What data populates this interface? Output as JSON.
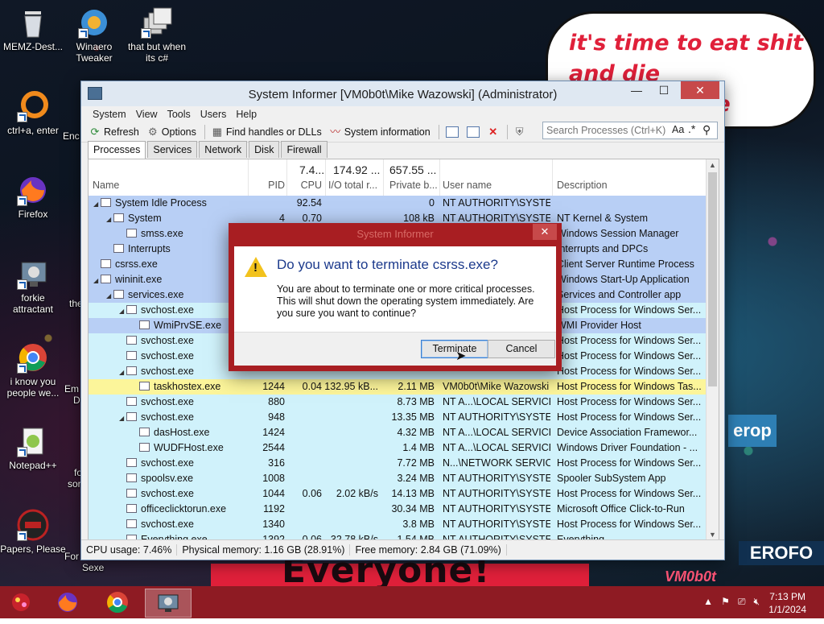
{
  "desktop": {
    "icons": [
      {
        "label": "MEMZ-Dest..."
      },
      {
        "label": "Winaero Tweaker"
      },
      {
        "label": "that but when its c#"
      },
      {
        "label": "ctrl+a, enter"
      },
      {
        "label": "Firefox"
      },
      {
        "label": "forkie attractant"
      },
      {
        "label": "i know you people we..."
      },
      {
        "label": "Notepad++"
      },
      {
        "label": "Papers, Please"
      }
    ],
    "partial_labels": {
      "enc": "Enc",
      "the": "the",
      "em": "Em",
      "d": "D",
      "fo": "fo",
      "sor": "sor",
      "for": "For",
      "sexe": "Sexe"
    },
    "bubble_text": "it's time to eat shit and die andcelebrate",
    "banner_text": "Everyone!",
    "vm_tag": "VM0b0t",
    "right_art_1": "erop",
    "right_art_2": "EROFO"
  },
  "window": {
    "title": "System Informer [VM0b0t\\Mike Wazowski] (Administrator)",
    "controls": {
      "minimize": "—",
      "maximize": "☐",
      "close": "✕"
    },
    "menu": [
      "System",
      "View",
      "Tools",
      "Users",
      "Help"
    ],
    "toolbar": {
      "refresh": "Refresh",
      "options": "Options",
      "find_handles": "Find handles or DLLs",
      "system_information": "System information"
    },
    "search": {
      "placeholder": "Search Processes (Ctrl+K)",
      "case": "Aa",
      "regex": ".*"
    },
    "tabs": [
      "Processes",
      "Services",
      "Network",
      "Disk",
      "Firewall"
    ],
    "columns": {
      "name": "Name",
      "pid": "PID",
      "cpu": "CPU",
      "io": "I/O total r...",
      "private": "Private b...",
      "user": "User name",
      "description": "Description"
    },
    "totals": {
      "cpu": "7.4...",
      "io": "174.92 ...",
      "private": "657.55 ..."
    },
    "rows": [
      {
        "indent": 1,
        "twisty": "◢",
        "name": "System Idle Process",
        "pid": "",
        "cpu": "92.54",
        "io": "",
        "priv": "0",
        "user": "NT AUTHORITY\\SYSTEM",
        "desc": "",
        "color": "#b8cff5"
      },
      {
        "indent": 2,
        "twisty": "◢",
        "name": "System",
        "pid": "4",
        "cpu": "0.70",
        "io": "",
        "priv": "108 kB",
        "user": "NT AUTHORITY\\SYSTEM",
        "desc": "NT Kernel & System",
        "color": "#b8cff5"
      },
      {
        "indent": 3,
        "twisty": "",
        "name": "smss.exe",
        "pid": "",
        "cpu": "",
        "io": "",
        "priv": "",
        "user": "",
        "desc": "Windows Session Manager",
        "color": "#b8cff5"
      },
      {
        "indent": 2,
        "twisty": "",
        "name": "Interrupts",
        "pid": "",
        "cpu": "",
        "io": "",
        "priv": "",
        "user": "",
        "desc": "Interrupts and DPCs",
        "color": "#b8cff5"
      },
      {
        "indent": 1,
        "twisty": "",
        "name": "csrss.exe",
        "pid": "",
        "cpu": "",
        "io": "",
        "priv": "",
        "user": "",
        "desc": "Client Server Runtime Process",
        "color": "#b8cff5"
      },
      {
        "indent": 1,
        "twisty": "◢",
        "name": "wininit.exe",
        "pid": "",
        "cpu": "",
        "io": "",
        "priv": "",
        "user": "",
        "desc": "Windows Start-Up Application",
        "color": "#b8cff5"
      },
      {
        "indent": 2,
        "twisty": "◢",
        "name": "services.exe",
        "pid": "",
        "cpu": "",
        "io": "",
        "priv": "",
        "user": "",
        "desc": "Services and Controller app",
        "color": "#b8cff5"
      },
      {
        "indent": 3,
        "twisty": "◢",
        "name": "svchost.exe",
        "pid": "",
        "cpu": "",
        "io": "",
        "priv": "",
        "user": "",
        "desc": "Host Process for Windows Ser...",
        "color": "#d0f2fb"
      },
      {
        "indent": 4,
        "twisty": "",
        "name": "WmiPrvSE.exe",
        "pid": "",
        "cpu": "",
        "io": "",
        "priv": "",
        "user": "",
        "desc": "WMI Provider Host",
        "color": "#b8cff5"
      },
      {
        "indent": 3,
        "twisty": "",
        "name": "svchost.exe",
        "pid": "",
        "cpu": "",
        "io": "",
        "priv": "",
        "user": "",
        "desc": "Host Process for Windows Ser...",
        "color": "#d0f2fb"
      },
      {
        "indent": 3,
        "twisty": "",
        "name": "svchost.exe",
        "pid": "",
        "cpu": "",
        "io": "",
        "priv": "",
        "user": "",
        "desc": "Host Process for Windows Ser...",
        "color": "#d0f2fb"
      },
      {
        "indent": 3,
        "twisty": "◢",
        "name": "svchost.exe",
        "pid": "",
        "cpu": "",
        "io": "",
        "priv": "",
        "user": "",
        "desc": "Host Process for Windows Ser...",
        "color": "#d0f2fb"
      },
      {
        "indent": 4,
        "twisty": "",
        "name": "taskhostex.exe",
        "pid": "1244",
        "cpu": "0.04",
        "io": "132.95 kB...",
        "priv": "2.11 MB",
        "user": "VM0b0t\\Mike Wazowski",
        "desc": "Host Process for Windows Tas...",
        "color": "#fcf59a"
      },
      {
        "indent": 3,
        "twisty": "",
        "name": "svchost.exe",
        "pid": "880",
        "cpu": "",
        "io": "",
        "priv": "8.73 MB",
        "user": "NT A...\\LOCAL SERVICE",
        "desc": "Host Process for Windows Ser...",
        "color": "#d0f2fb"
      },
      {
        "indent": 3,
        "twisty": "◢",
        "name": "svchost.exe",
        "pid": "948",
        "cpu": "",
        "io": "",
        "priv": "13.35 MB",
        "user": "NT AUTHORITY\\SYSTEM",
        "desc": "Host Process for Windows Ser...",
        "color": "#d0f2fb"
      },
      {
        "indent": 4,
        "twisty": "",
        "name": "dasHost.exe",
        "pid": "1424",
        "cpu": "",
        "io": "",
        "priv": "4.32 MB",
        "user": "NT A...\\LOCAL SERVICE",
        "desc": "Device Association Framewor...",
        "color": "#d0f2fb"
      },
      {
        "indent": 4,
        "twisty": "",
        "name": "WUDFHost.exe",
        "pid": "2544",
        "cpu": "",
        "io": "",
        "priv": "1.4 MB",
        "user": "NT A...\\LOCAL SERVICE",
        "desc": "Windows Driver Foundation - ...",
        "color": "#d0f2fb"
      },
      {
        "indent": 3,
        "twisty": "",
        "name": "svchost.exe",
        "pid": "316",
        "cpu": "",
        "io": "",
        "priv": "7.72 MB",
        "user": "N...\\NETWORK SERVICE",
        "desc": "Host Process for Windows Ser...",
        "color": "#d0f2fb"
      },
      {
        "indent": 3,
        "twisty": "",
        "name": "spoolsv.exe",
        "pid": "1008",
        "cpu": "",
        "io": "",
        "priv": "3.24 MB",
        "user": "NT AUTHORITY\\SYSTEM",
        "desc": "Spooler SubSystem App",
        "color": "#d0f2fb"
      },
      {
        "indent": 3,
        "twisty": "",
        "name": "svchost.exe",
        "pid": "1044",
        "cpu": "0.06",
        "io": "2.02 kB/s",
        "priv": "14.13 MB",
        "user": "NT AUTHORITY\\SYSTEM",
        "desc": "Host Process for Windows Ser...",
        "color": "#d0f2fb"
      },
      {
        "indent": 3,
        "twisty": "",
        "name": "officeclicktorun.exe",
        "pid": "1192",
        "cpu": "",
        "io": "",
        "priv": "30.34 MB",
        "user": "NT AUTHORITY\\SYSTEM",
        "desc": "Microsoft Office Click-to-Run",
        "color": "#d0f2fb"
      },
      {
        "indent": 3,
        "twisty": "",
        "name": "svchost.exe",
        "pid": "1340",
        "cpu": "",
        "io": "",
        "priv": "3.8 MB",
        "user": "NT AUTHORITY\\SYSTEM",
        "desc": "Host Process for Windows Ser...",
        "color": "#d0f2fb"
      },
      {
        "indent": 3,
        "twisty": "",
        "name": "Everything.exe",
        "pid": "1392",
        "cpu": "0.06",
        "io": "32.78 kB/s",
        "priv": "1.54 MB",
        "user": "NT AUTHORITY\\SYSTEM",
        "desc": "Everything",
        "color": "#d0f2fb"
      }
    ],
    "status": {
      "cpu": "CPU usage: 7.46%",
      "physical": "Physical memory: 1.16 GB (28.91%)",
      "free": "Free memory: 2.84 GB (71.09%)"
    }
  },
  "dialog": {
    "title": "System Informer",
    "close": "✕",
    "heading": "Do you want to terminate csrss.exe?",
    "text": "You are about to terminate one or more critical processes. This will shut down the operating system immediately. Are you sure you want to continue?",
    "terminate": "Terminate",
    "cancel": "Cancel"
  },
  "taskbar": {
    "time": "7:13 PM",
    "date": "1/1/2024"
  },
  "colors": {
    "taskbar": "#8e1b23",
    "dialog_frame": "#a81e22",
    "highlight_blue": "#b8cff5",
    "service_cyan": "#d0f2fb",
    "user_yellow": "#fcf59a",
    "close_red": "#c7494a"
  }
}
